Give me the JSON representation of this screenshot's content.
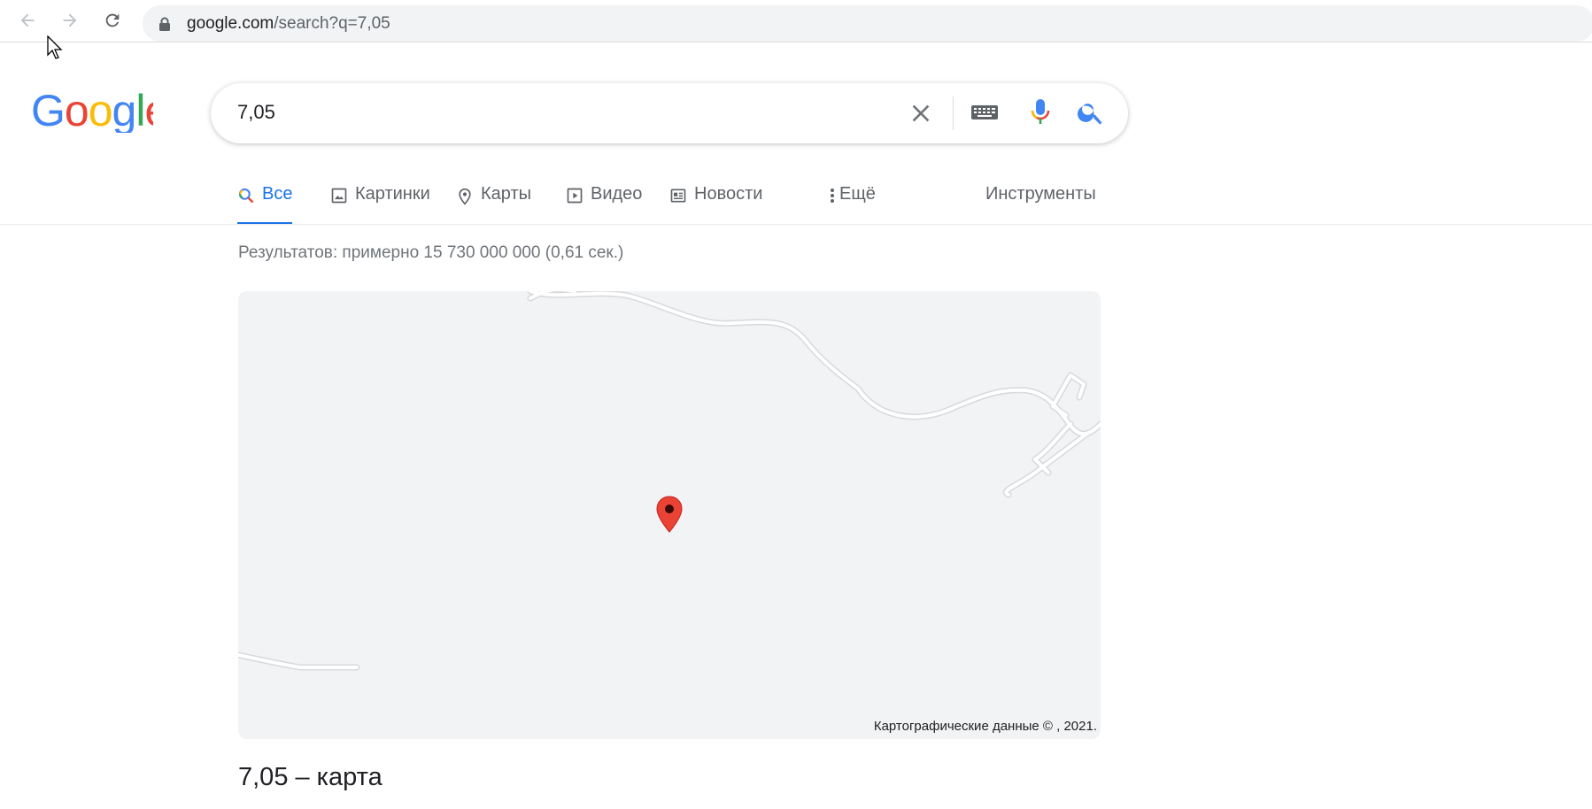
{
  "browser": {
    "url_host": "google.com",
    "url_path": "/search?q=7,05"
  },
  "search": {
    "query": "7,05"
  },
  "tabs": [
    {
      "label": "Все",
      "icon": "search-icon",
      "active": true
    },
    {
      "label": "Картинки",
      "icon": "image-icon",
      "active": false
    },
    {
      "label": "Карты",
      "icon": "map-pin-icon",
      "active": false
    },
    {
      "label": "Видео",
      "icon": "video-icon",
      "active": false
    },
    {
      "label": "Новости",
      "icon": "news-icon",
      "active": false
    },
    {
      "label": "Ещё",
      "icon": "more-vert-icon",
      "active": false
    }
  ],
  "tools_label": "Инструменты",
  "stats": "Результатов: примерно 15 730 000 000 (0,61 сек.)",
  "map": {
    "attribution": "Картографические данные © , 2021."
  },
  "result": {
    "title": "7,05 – карта"
  },
  "colors": {
    "accent": "#1a73e8",
    "pin": "#ea4335",
    "map_bg": "#f1f3f4"
  }
}
